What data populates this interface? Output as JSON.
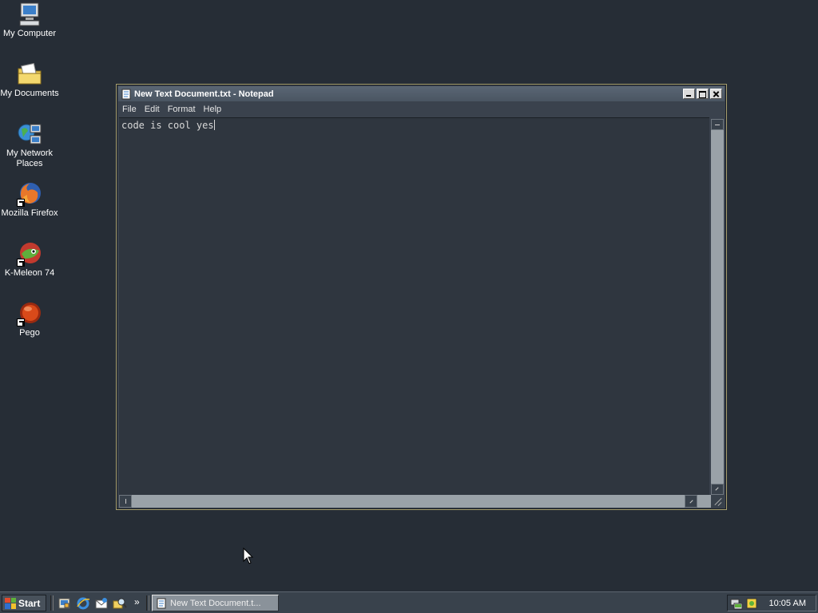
{
  "desktop": {
    "icons": [
      {
        "label": "My Computer",
        "icon": "computer-icon"
      },
      {
        "label": "My Documents",
        "icon": "folder-documents-icon"
      },
      {
        "label": "My Network Places",
        "icon": "network-places-icon"
      },
      {
        "label": "Mozilla Firefox",
        "icon": "firefox-icon"
      },
      {
        "label": "K-Meleon 74",
        "icon": "k-meleon-icon"
      },
      {
        "label": "Pego",
        "icon": "pego-icon"
      }
    ]
  },
  "window": {
    "title": "New Text Document.txt - Notepad",
    "menu": [
      "File",
      "Edit",
      "Format",
      "Help"
    ],
    "content": "code is cool yes"
  },
  "taskbar": {
    "start_label": "Start",
    "quick_launch": [
      "show-desktop-icon",
      "internet-explorer-icon",
      "outlook-express-icon",
      "search-icon"
    ],
    "more_label": "»",
    "task_label": "New Text Document.t...",
    "clock": "10:05 AM"
  },
  "colors": {
    "desktop": "#262d36",
    "titlebar": "#4f5a67",
    "window_border": "#a8a070"
  }
}
